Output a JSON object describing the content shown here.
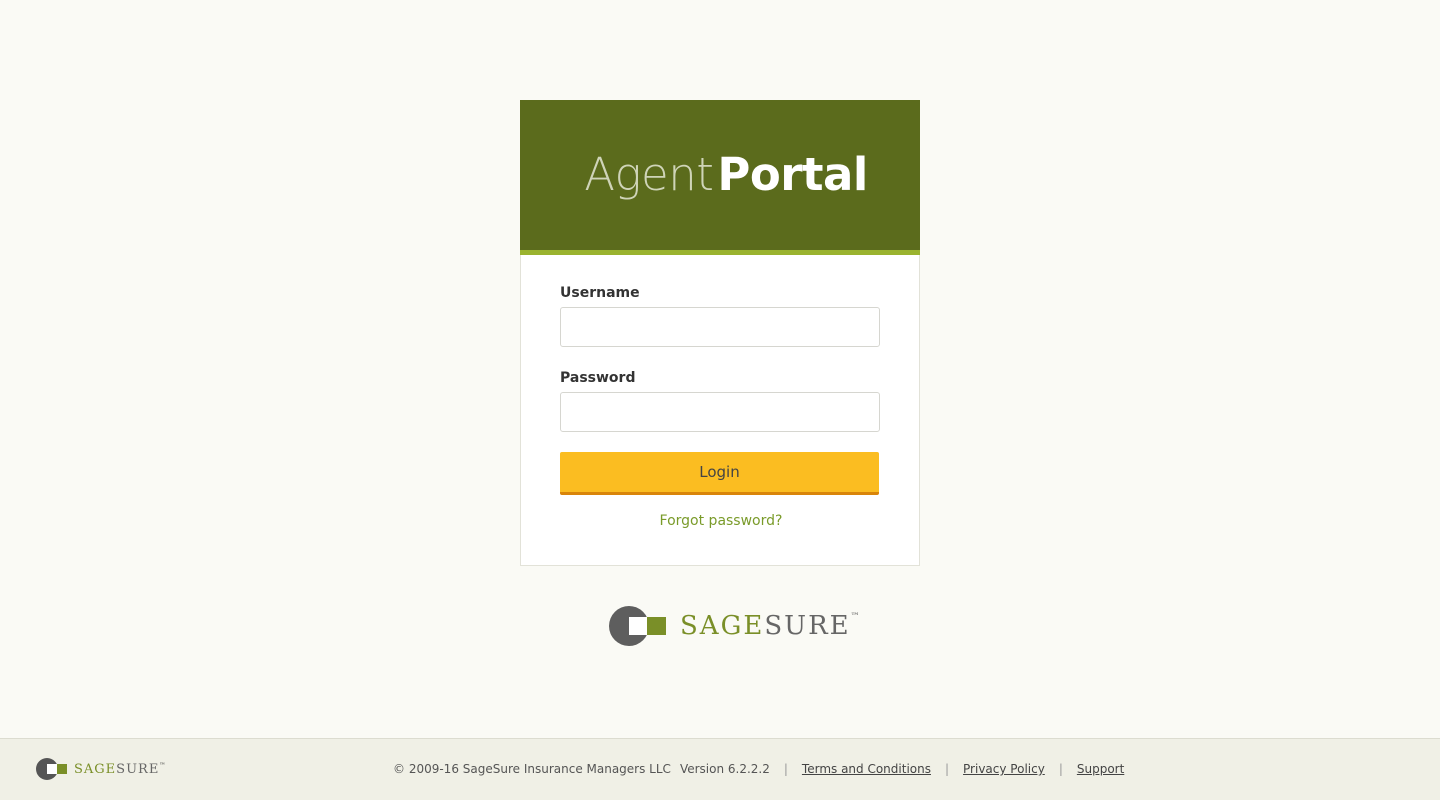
{
  "header": {
    "brand_light": "Agent",
    "brand_bold": "Portal"
  },
  "form": {
    "username_label": "Username",
    "username_value": "",
    "password_label": "Password",
    "password_value": "",
    "login_label": "Login",
    "forgot_label": "Forgot password?"
  },
  "logo": {
    "sage": "SAGE",
    "sure": "SURE",
    "tm": "™"
  },
  "footer": {
    "logo_sage": "SAGE",
    "logo_sure": "SURE",
    "logo_tm": "™",
    "copyright": "© 2009-16 SageSure Insurance Managers LLC",
    "version": "Version 6.2.2.2",
    "links": [
      "Terms and Conditions",
      "Privacy Policy",
      "Support"
    ],
    "separator": "|"
  },
  "colors": {
    "header_bg": "#5b6b1c",
    "header_accent": "#9ab32f",
    "button_bg": "#fbbd21",
    "link": "#7a9b2a"
  }
}
